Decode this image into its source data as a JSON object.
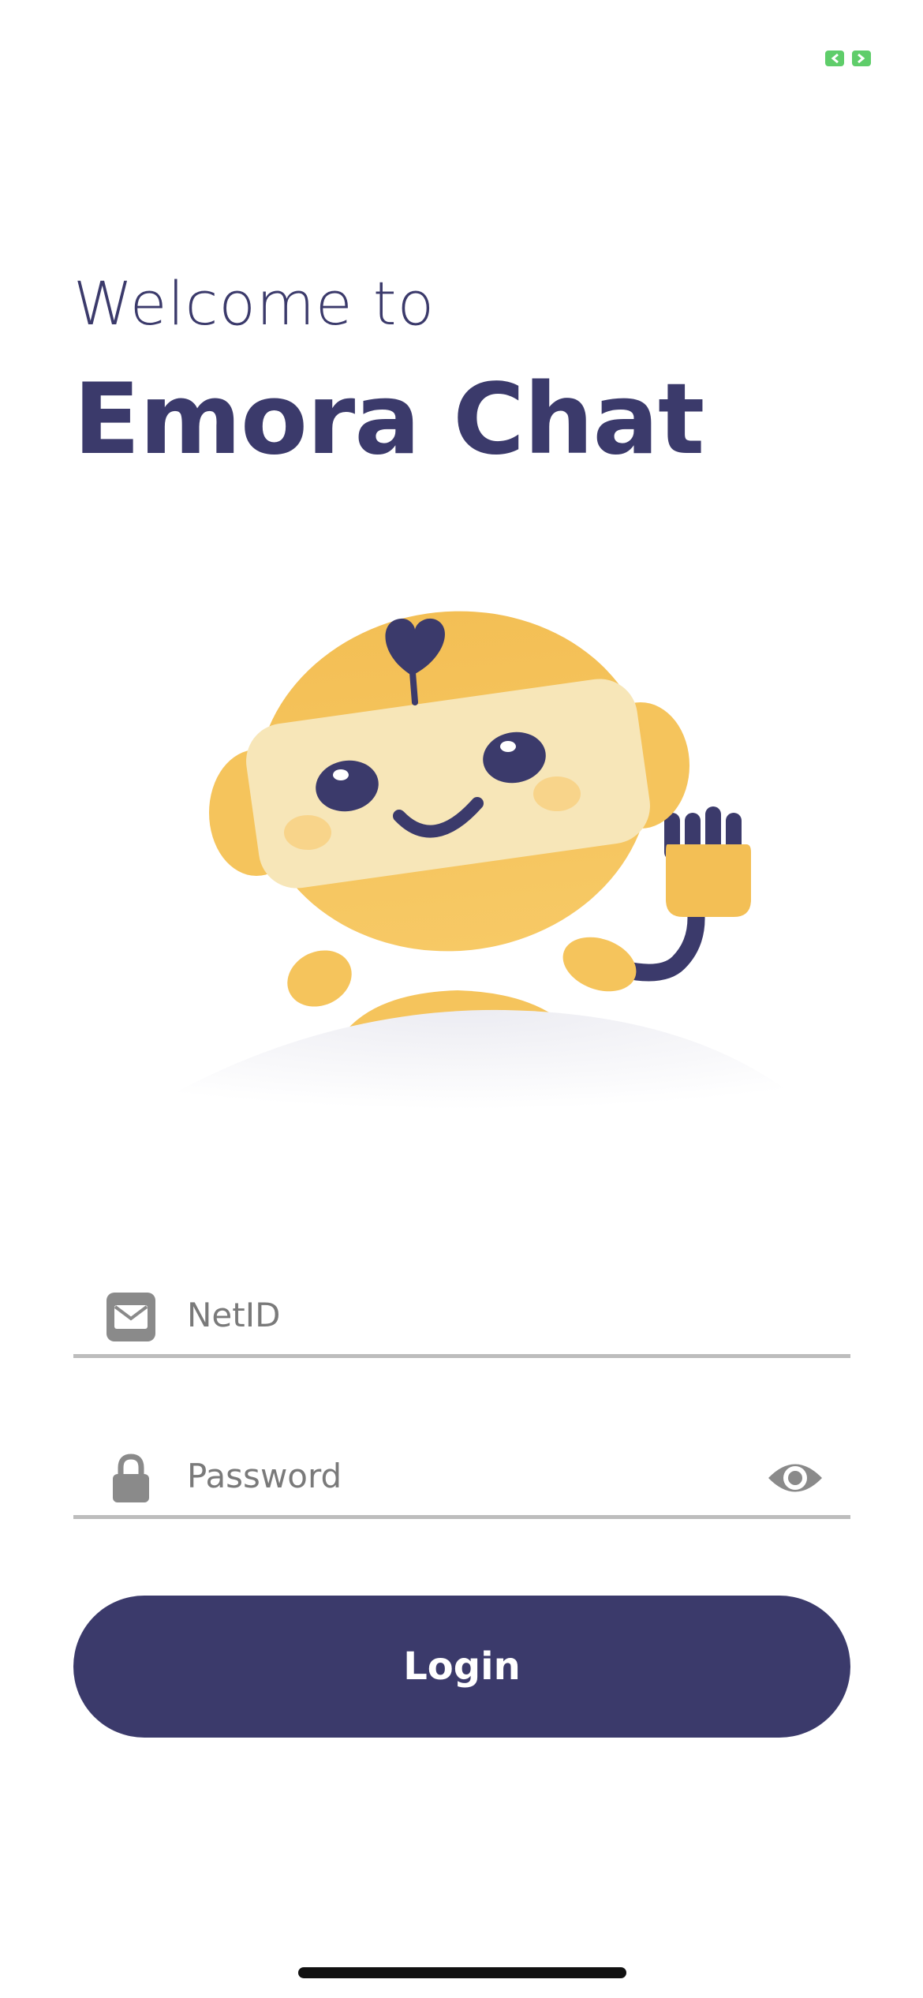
{
  "header": {
    "welcome_text": "Welcome to",
    "app_name": "Emora Chat"
  },
  "form": {
    "netid": {
      "placeholder": "NetID",
      "value": "",
      "icon": "mail-icon"
    },
    "password": {
      "placeholder": "Password",
      "value": "",
      "icon": "lock-icon",
      "toggle_icon": "eye-icon"
    },
    "login_label": "Login"
  },
  "colors": {
    "primary": "#3b3a6b",
    "mascot_yellow": "#f5c45c",
    "field_underline": "#bdbdbd",
    "icon_gray": "#8a8a8a",
    "status_green": "#5fcd6a"
  }
}
